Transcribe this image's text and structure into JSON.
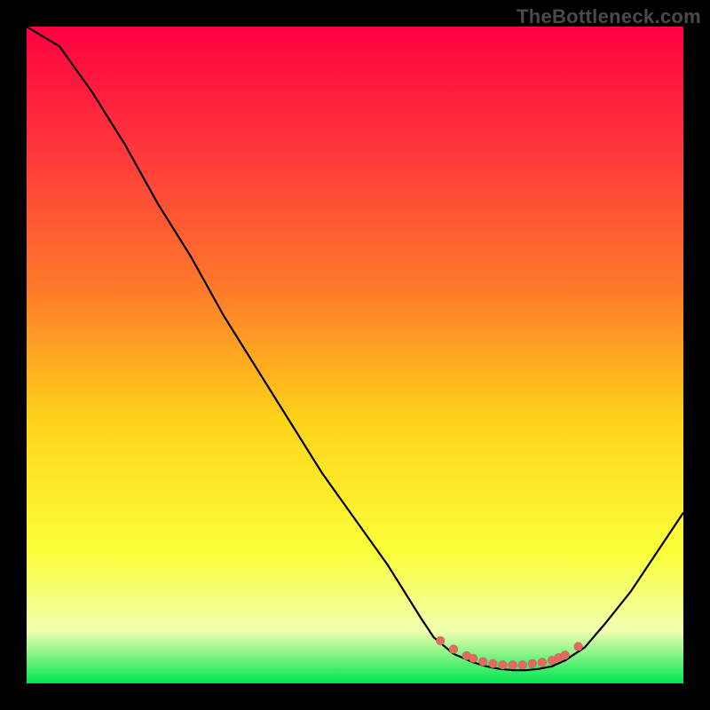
{
  "watermark": "TheBottleneck.com",
  "gradient_colors": {
    "top": "#ff0040",
    "upper_mid": "#ff3b3b",
    "mid": "#ff7a2a",
    "lower_mid": "#ffd31a",
    "low": "#fbff3a",
    "near_bottom": "#f2ffb0",
    "bottom": "#00e651"
  },
  "marker_color": "#e26a5f",
  "curve_color": "#000000",
  "chart_data": {
    "type": "line",
    "title": "",
    "xlabel": "",
    "ylabel": "",
    "xlim": [
      0,
      100
    ],
    "ylim": [
      0,
      100
    ],
    "x": [
      0,
      5,
      10,
      15,
      20,
      25,
      30,
      35,
      40,
      45,
      50,
      55,
      60,
      62,
      65,
      68,
      70,
      72,
      74,
      76,
      78,
      80,
      82,
      85,
      88,
      92,
      96,
      100
    ],
    "values": [
      100,
      97,
      90,
      82,
      73,
      65,
      56,
      48,
      40,
      32,
      25,
      18,
      10,
      7,
      4.5,
      3.2,
      2.6,
      2.2,
      2.0,
      2.0,
      2.2,
      2.6,
      3.5,
      5.5,
      9,
      14,
      20,
      26
    ],
    "markers_x": [
      63,
      65,
      67,
      68,
      69.5,
      71,
      72.5,
      74,
      75.5,
      77,
      78.5,
      80,
      81,
      82,
      84
    ],
    "markers_y": [
      6.5,
      5.2,
      4.2,
      3.8,
      3.3,
      3.0,
      2.8,
      2.8,
      2.8,
      3.0,
      3.2,
      3.5,
      3.9,
      4.3,
      5.6
    ],
    "legend": [],
    "grid": false,
    "annotations": []
  }
}
